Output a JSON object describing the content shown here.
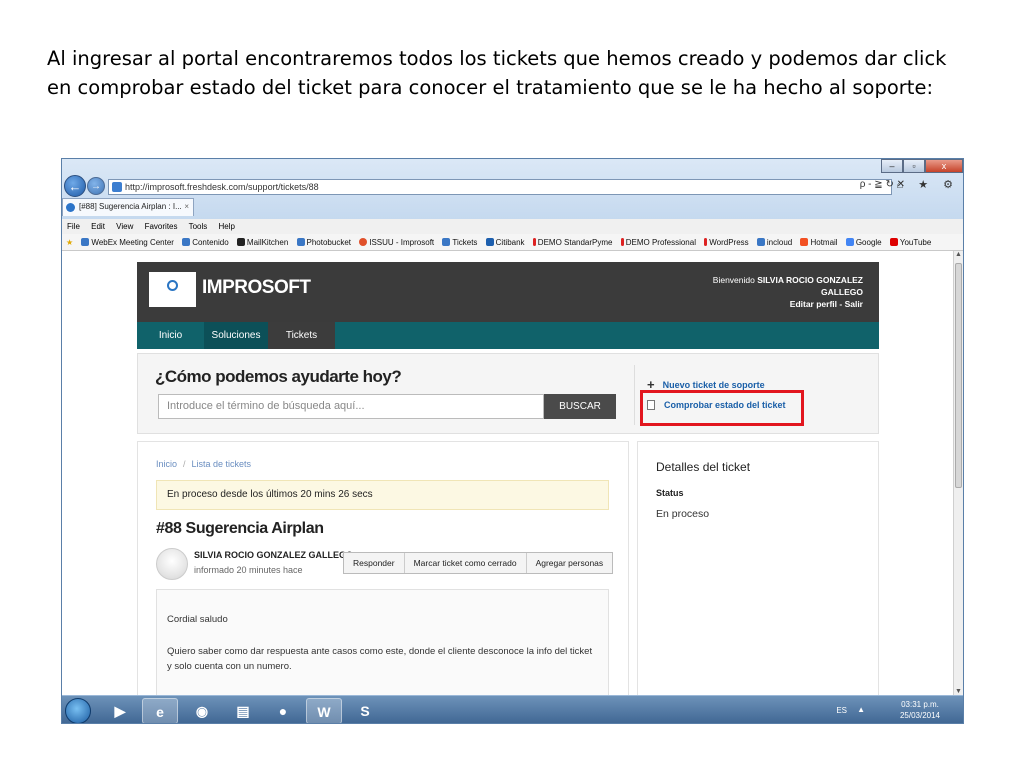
{
  "caption": "Al ingresar al portal encontraremos todos los tickets que hemos creado y podemos dar click en comprobar estado del ticket para conocer el tratamiento que se le ha hecho al soporte:",
  "browser": {
    "address": "http://improsoft.freshdesk.com/support/tickets/88",
    "tab_title": "[#88] Sugerencia Airplan : I...",
    "tab_close": "×",
    "menu": [
      "File",
      "Edit",
      "View",
      "Favorites",
      "Tools",
      "Help"
    ],
    "favorites": [
      "WebEx Meeting Center",
      "Contenido",
      "MailKitchen",
      "Photobucket",
      "ISSUU - Improsoft",
      "Tickets",
      "Citibank",
      "DEMO StandarPyme",
      "DEMO Professional",
      "WordPress",
      "incloud",
      "Hotmail",
      "Google",
      "YouTube"
    ],
    "address_tools": "ρ - ≧ ↻ ✕",
    "right_icons": "⌂ ★ ⚙",
    "win_controls": [
      "–",
      "▫",
      "x"
    ]
  },
  "portal": {
    "brand": "IMPROSOFT",
    "welcome_prefix": "Bienvenido ",
    "user_name": "SILVIA ROCIO GONZALEZ GALLEGO",
    "profile_links": "Editar perfil - Salir",
    "nav": [
      "Inicio",
      "Soluciones",
      "Tickets"
    ],
    "question": "¿Cómo podemos ayudarte hoy?",
    "search_placeholder": "Introduce el término de búsqueda aquí...",
    "search_button": "BUSCAR",
    "new_ticket": "Nuevo ticket de soporte",
    "check_status": "Comprobar estado del ticket"
  },
  "ticket": {
    "breadcrumb": [
      "Inicio",
      "Lista de tickets"
    ],
    "breadcrumb_sep": "/",
    "status_alert": "En proceso desde los últimos 20 mins 26 secs",
    "title": "#88 Sugerencia Airplan",
    "reporter": "SILVIA ROCIO GONZALEZ GALLEGO",
    "reported": "informado 20 minutes hace",
    "actions": [
      "Responder",
      "Marcar ticket como cerrado",
      "Agregar personas"
    ],
    "message": [
      "Cordial saludo",
      "Quiero saber como dar respuesta ante casos como este, donde el cliente desconoce la info del ticket y solo cuenta con un numero."
    ]
  },
  "details": {
    "title": "Detalles del ticket",
    "status_label": "Status",
    "status_value": "En proceso"
  },
  "taskbar": {
    "lang": "ES",
    "time": "03:31 p.m.",
    "date": "25/03/2014"
  },
  "colors": {
    "highlight": "#e2161e",
    "nav_bar": "#10626a",
    "header": "#3b3b3b"
  }
}
